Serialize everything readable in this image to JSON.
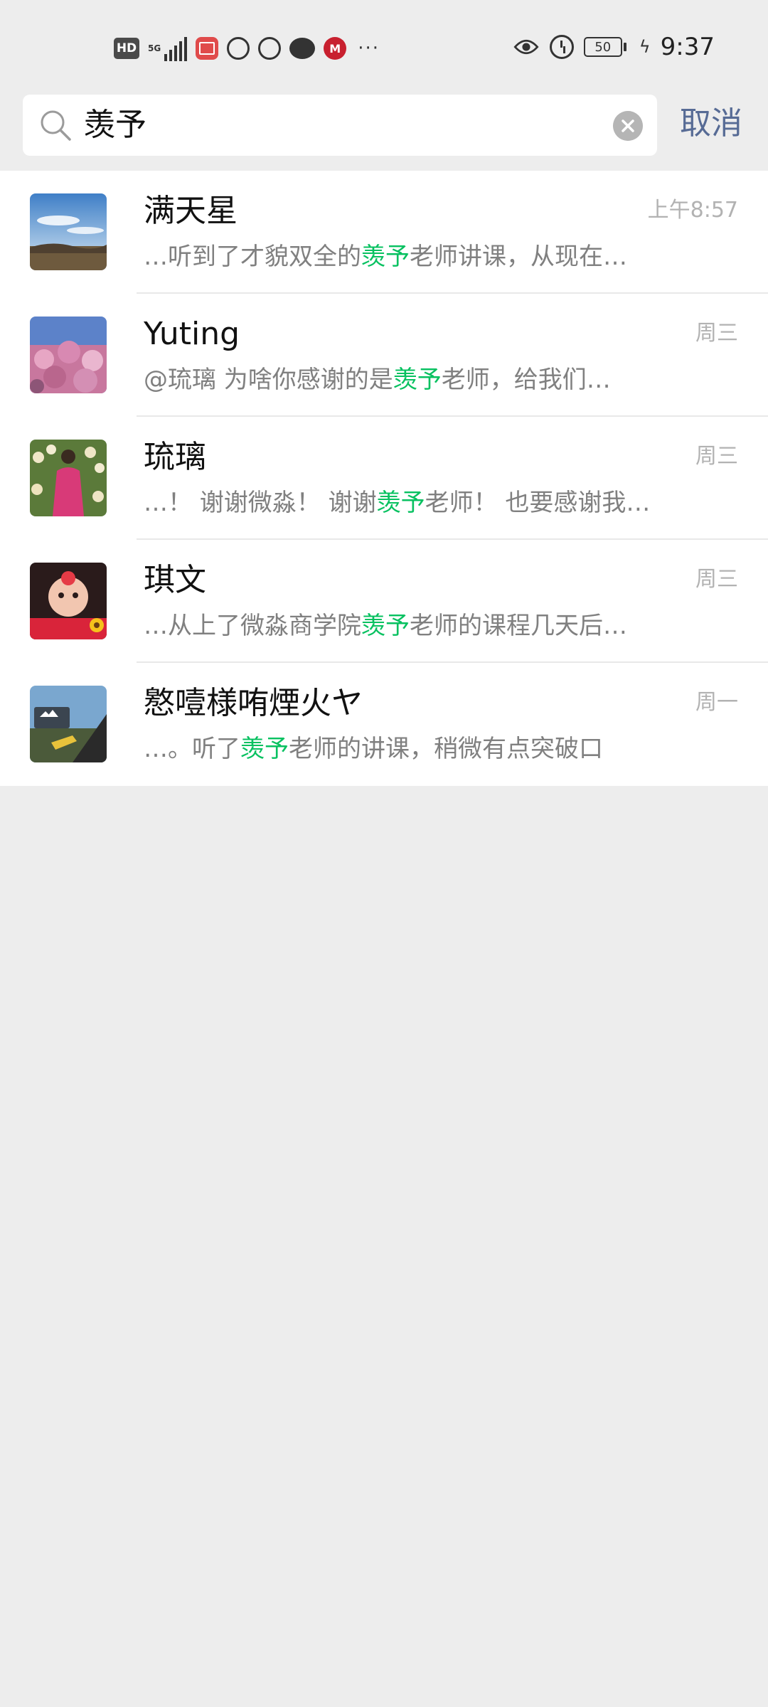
{
  "status_bar": {
    "hd_label": "HD",
    "network_label": "5G",
    "battery_level": "50",
    "time": "9:37",
    "icons": [
      "hd-icon",
      "signal-icon",
      "reader-app-icon",
      "hand-icon",
      "alarm-icon",
      "chat-icon",
      "metro-icon",
      "more-icon",
      "eye-icon",
      "alarm-clock-icon",
      "battery-icon",
      "charging-icon"
    ]
  },
  "search": {
    "query": "羡予",
    "cancel_label": "取消"
  },
  "colors": {
    "highlight": "#07c160",
    "link": "#576b95",
    "background": "#ededed"
  },
  "results": [
    {
      "name": "满天星",
      "time": "上午8:57",
      "snippet_before": "…听到了才貌双全的",
      "snippet_match": "羡予",
      "snippet_after": "老师讲课，从现在…",
      "avatar": "landscape-sky"
    },
    {
      "name": "Yuting",
      "time": "周三",
      "snippet_before": "@琉璃 为啥你感谢的是",
      "snippet_match": "羡予",
      "snippet_after": "老师，给我们…",
      "avatar": "pink-flowers"
    },
    {
      "name": "琉璃",
      "time": "周三",
      "snippet_before": "…！ 谢谢微淼！ 谢谢",
      "snippet_match": "羡予",
      "snippet_after": "老师！ 也要感谢我…",
      "avatar": "woman-in-flower-field"
    },
    {
      "name": "琪文",
      "time": "周三",
      "snippet_before": "…从上了微淼商学院",
      "snippet_match": "羡予",
      "snippet_after": "老师的课程几天后…",
      "avatar": "baby-with-sunflowers"
    },
    {
      "name": "㦘噎様哊煙火ヤ",
      "time": "周一",
      "snippet_before": "…。听了",
      "snippet_match": "羡予",
      "snippet_after": "老师的讲课，稍微有点突破口",
      "avatar": "mount-dobson-park"
    }
  ]
}
